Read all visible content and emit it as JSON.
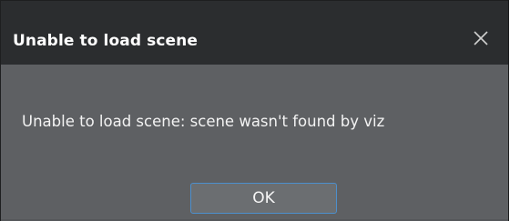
{
  "dialog": {
    "title": "Unable to load scene",
    "message": "Unable to load scene: scene wasn't found by viz",
    "ok_label": "OK",
    "close_icon": "close-icon"
  },
  "colors": {
    "titlebar": "#2b2d2f",
    "body": "#5e6063",
    "button": "#6b6e71",
    "button_border": "#4d8fcc",
    "text": "#ffffff"
  }
}
